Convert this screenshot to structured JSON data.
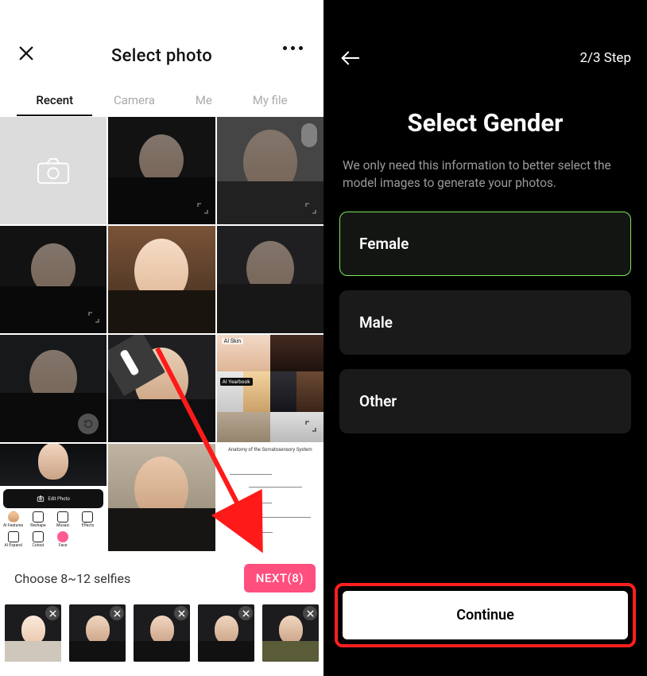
{
  "left": {
    "title": "Select photo",
    "tabs": [
      "Recent",
      "Camera",
      "Me",
      "My file"
    ],
    "activeTab": 0,
    "footerText": "Choose 8~12 selfies",
    "nextLabel": "NEXT(8)",
    "editor": {
      "barLabel": "Edit Photo",
      "tools": [
        "AI Features",
        "Reshape",
        "Mosaic",
        "Effects",
        "AI Expand",
        "Cutout",
        "Face"
      ]
    },
    "collage": {
      "topLabel": "AI Skin",
      "midLabel": "AI Yearbook"
    },
    "diagramTitle": "Anatomy of the Somatosensory System"
  },
  "right": {
    "stepText": "2/3 Step",
    "title": "Select Gender",
    "subtitle": "We only need this information to better select the model images to generate your photos.",
    "options": [
      "Female",
      "Male",
      "Other"
    ],
    "selected": 0,
    "continueLabel": "Continue"
  }
}
